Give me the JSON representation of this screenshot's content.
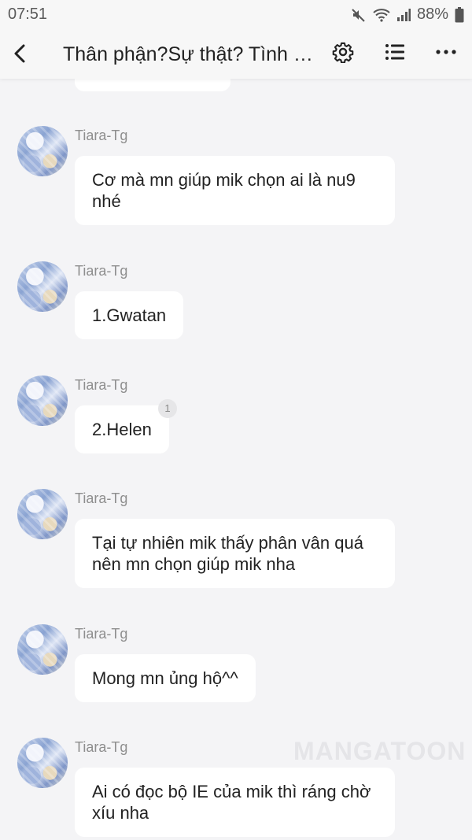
{
  "status_bar": {
    "time": "07:51",
    "battery": "88%"
  },
  "header": {
    "title": "Thân phận?Sự thật? Tình yêu?"
  },
  "watermark": "MANGATOON",
  "messages": [
    {
      "author": "Tiara-Tg",
      "text": "Cơ mà mn giúp mik chọn ai là nu9 nhé"
    },
    {
      "author": "Tiara-Tg",
      "text": "1.Gwatan"
    },
    {
      "author": "Tiara-Tg",
      "text": "2.Helen",
      "badge": "1"
    },
    {
      "author": "Tiara-Tg",
      "text": "Tại tự nhiên mik thấy phân vân quá nên mn chọn giúp mik nha"
    },
    {
      "author": "Tiara-Tg",
      "text": "Mong mn ủng hộ^^"
    },
    {
      "author": "Tiara-Tg",
      "text": "Ai có đọc bộ IE của mik thì ráng chờ xíu nha"
    }
  ]
}
